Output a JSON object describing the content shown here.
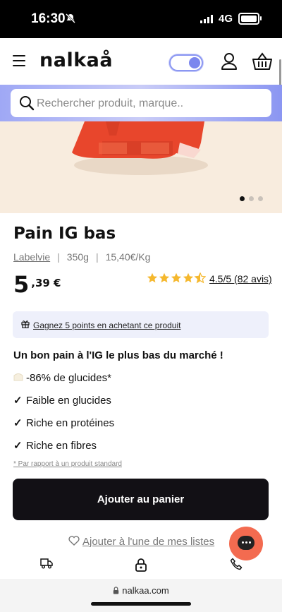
{
  "status_bar": {
    "time": "16:30",
    "network": "4G"
  },
  "header": {
    "logo": "nalkaå"
  },
  "search": {
    "placeholder": "Rechercher produit, marque.."
  },
  "product": {
    "title": "Pain IG bas",
    "brand": "Labelvie",
    "weight": "350g",
    "unit_price": "15,40€/Kg",
    "price_int": "5",
    "price_dec": ",39 €",
    "rating": 4.5,
    "rating_text": "4.5/5 (82 avis)",
    "carousel_slides": 3,
    "carousel_active": 1
  },
  "points": {
    "text": "Gagnez 5 points en achetant ce produit"
  },
  "description": {
    "tagline": "Un bon pain à l'IG le plus bas du marché !",
    "features": [
      "-86% de glucides*",
      "Faible en glucides",
      "Riche en protéines",
      "Riche en fibres"
    ],
    "footnote": "* Par rapport à un produit standard"
  },
  "actions": {
    "add_to_cart": "Ajouter au panier",
    "wishlist": "Ajouter à l'une de mes listes"
  },
  "browser": {
    "url": "nalkaa.com"
  },
  "colors": {
    "accent": "#8b96f2",
    "chat": "#f36b50",
    "button": "#121015",
    "star": "#f5b82e"
  }
}
